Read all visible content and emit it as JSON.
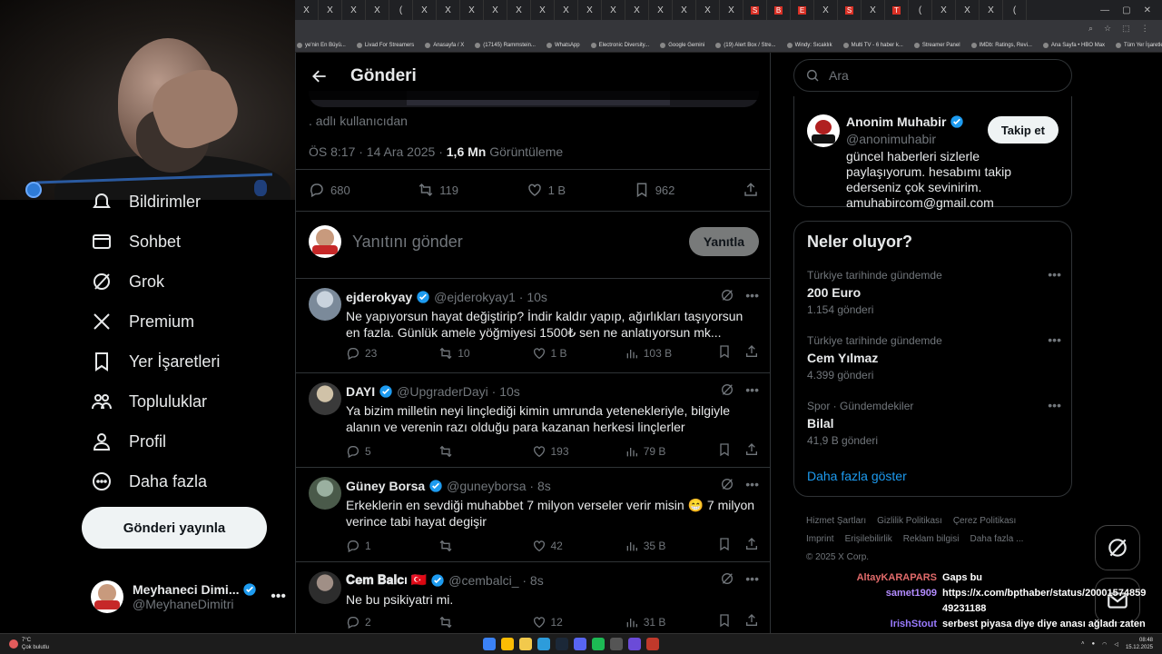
{
  "browser": {
    "tabs": [
      "X",
      "X",
      "X",
      "X",
      "(",
      "X",
      "X",
      "X",
      "X",
      "X",
      "X",
      "X",
      "X",
      "X",
      "X",
      "X",
      "X",
      "X",
      "X",
      "S",
      "B",
      "E",
      "X",
      "S",
      "X",
      "T",
      "(",
      "X",
      "X",
      "X",
      "("
    ],
    "bookmarks": [
      "ye'nin En Büyü...",
      "Livad For Streamers",
      "Anasayfa / X",
      "(17145) Rammstein...",
      "WhatsApp",
      "Electronic Diversity...",
      "Google Gemini",
      "(19) Alert Box / Stre...",
      "Windy: Sıcaklık",
      "Multi TV - 6 haber k...",
      "Streamer Panel",
      "IMDb: Ratings, Revi...",
      "Ana Sayfa • HBO Max",
      "Tüm Yer İşaretleri"
    ]
  },
  "nav": {
    "items": [
      {
        "label": "Bildirimler",
        "icon": "bell-icon"
      },
      {
        "label": "Sohbet",
        "icon": "mail-icon"
      },
      {
        "label": "Grok",
        "icon": "grok-icon"
      },
      {
        "label": "Premium",
        "icon": "x-logo-icon"
      },
      {
        "label": "Yer İşaretleri",
        "icon": "bookmark-icon"
      },
      {
        "label": "Topluluklar",
        "icon": "communities-icon"
      },
      {
        "label": "Profil",
        "icon": "profile-icon"
      },
      {
        "label": "Daha fazla",
        "icon": "more-circle-icon"
      }
    ],
    "post_button": "Gönderi yayınla",
    "account": {
      "name": "Meyhaneci Dimi...",
      "handle": "@MeyhaneDimitri"
    }
  },
  "main": {
    "title": "Gönderi",
    "from_user": ". adlı kullanıcıdan",
    "meta_time": "ÖS 8:17 · 14 Ara 2025 · ",
    "views_count": "1,6 Mn",
    "views_label": " Görüntüleme",
    "stats": {
      "replies": "680",
      "reposts": "119",
      "likes": "1 B",
      "bookmarks": "962"
    },
    "reply_placeholder": "Yanıtını gönder",
    "reply_button": "Yanıtla",
    "replies": [
      {
        "name": "ejderokyay",
        "handle": "@ejderokyay1 · 10s",
        "text": "Ne yapıyorsun hayat değiştirip? İndir kaldır yapıp, ağırlıkları taşıyorsun en fazla. Günlük amele yöğmiyesi 1500₺ sen ne anlatıyorsun mk...",
        "replies": "23",
        "reposts": "10",
        "likes": "1 B",
        "views": "103 B"
      },
      {
        "name": "DAYI",
        "handle": "@UpgraderDayi · 10s",
        "text": "Ya bizim milletin neyi linçlediği kimin umrunda yetenekleriyle, bilgiyle alanın ve verenin razı olduğu para kazanan herkesi linçlerler",
        "replies": "5",
        "reposts": "",
        "likes": "193",
        "views": "79 B"
      },
      {
        "name": "Güney Borsa",
        "handle": "@guneyborsa · 8s",
        "text": "Erkeklerin en sevdiği muhabbet 7 milyon verseler verir misin 😁 7 milyon verince tabi hayat degişir",
        "replies": "1",
        "reposts": "",
        "likes": "42",
        "views": "35 B"
      },
      {
        "name": "𝐂𝐞𝐦 𝐁𝐚𝐥𝐜ı 🇹🇷",
        "handle": "@cembalci_ · 8s",
        "text": "Ne bu psikiyatri mi.",
        "replies": "2",
        "reposts": "",
        "likes": "12",
        "views": "31 B"
      }
    ]
  },
  "right": {
    "search_placeholder": "Ara",
    "profile": {
      "name": "Anonim Muhabir",
      "handle": "@anonimuhabir",
      "follow": "Takip et",
      "bio": "güncel haberleri sizlerle paylaşıyorum. hesabımı takip ederseniz çok sevinirim. amuhabircom@gmail.com"
    },
    "trends_title": "Neler oluyor?",
    "trends": [
      {
        "context": "Türkiye tarihinde gündemde",
        "title": "200 Euro",
        "count": "1.154 gönderi"
      },
      {
        "context": "Türkiye tarihinde gündemde",
        "title": "Cem Yılmaz",
        "count": "4.399 gönderi"
      },
      {
        "context": "Spor · Gündemdekiler",
        "title": "Bilal",
        "count": "41,9 B gönderi"
      }
    ],
    "show_more": "Daha fazla göster",
    "footer": [
      "Hizmet Şartları",
      "Gizlilik Politikası",
      "Çerez Politikası",
      "Imprint",
      "Erişilebilirlik",
      "Reklam bilgisi",
      "Daha fazla ...",
      "© 2025 X Corp."
    ]
  },
  "chat": [
    {
      "user": "AltayKARAPARS",
      "msg": "Gaps bu"
    },
    {
      "user": "samet1909",
      "msg": "https://x.com/bpthaber/status/2000157485949231188"
    },
    {
      "user": "IrishStout",
      "msg": "serbest piyasa diye diye anası ağladı zaten ortalığın"
    }
  ],
  "taskbar": {
    "weather_temp": "7°C",
    "weather_desc": "Çok bulutlu",
    "time": "08:48",
    "date": "15.12.2025"
  },
  "colors": {
    "accent": "#1d9bf0",
    "background": "#000000",
    "border": "#2f3336",
    "muted": "#71767b"
  }
}
